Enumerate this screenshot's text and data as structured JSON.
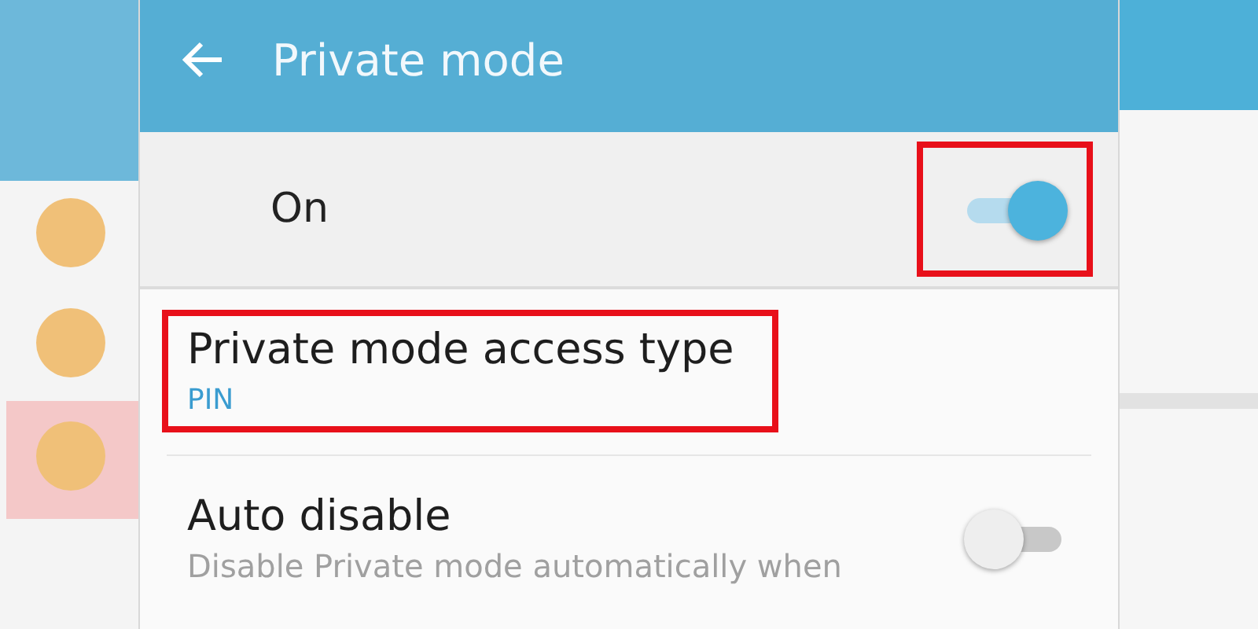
{
  "header": {
    "title": "Private mode"
  },
  "master_switch": {
    "label": "On",
    "on": true,
    "highlighted": true
  },
  "settings": [
    {
      "kind": "value",
      "title": "Private mode access type",
      "value": "PIN",
      "highlighted": true
    },
    {
      "kind": "toggle",
      "title": "Auto disable",
      "description": "Disable Private mode automatically when",
      "on": false,
      "highlighted": false
    }
  ]
}
